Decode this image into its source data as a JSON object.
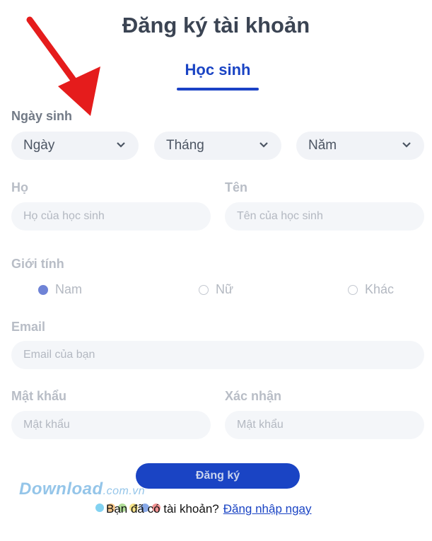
{
  "title": "Đăng ký tài khoản",
  "tab": {
    "label": "Học sinh"
  },
  "birth": {
    "label": "Ngày sinh",
    "day": "Ngày",
    "month": "Tháng",
    "year": "Năm"
  },
  "lastname": {
    "label": "Họ",
    "placeholder": "Họ của học sinh"
  },
  "firstname": {
    "label": "Tên",
    "placeholder": "Tên của học sinh"
  },
  "gender": {
    "label": "Giới tính",
    "options": [
      "Nam",
      "Nữ",
      "Khác"
    ],
    "selected": "Nam"
  },
  "email": {
    "label": "Email",
    "placeholder": "Email của bạn"
  },
  "password": {
    "label": "Mật khẩu",
    "placeholder": "Mật khẩu"
  },
  "confirm": {
    "label": "Xác nhận",
    "placeholder": "Mật khẩu"
  },
  "submit_label": "Đăng ký",
  "login": {
    "prompt": "Bạn đã có tài khoản?",
    "link": "Đăng nhập ngay"
  },
  "watermark": {
    "main": "Download",
    "suffix": ".com.vn"
  },
  "colors": {
    "accent": "#1a44c4",
    "arrow": "#e51c1c",
    "radio_checked": "#6f83d6"
  }
}
